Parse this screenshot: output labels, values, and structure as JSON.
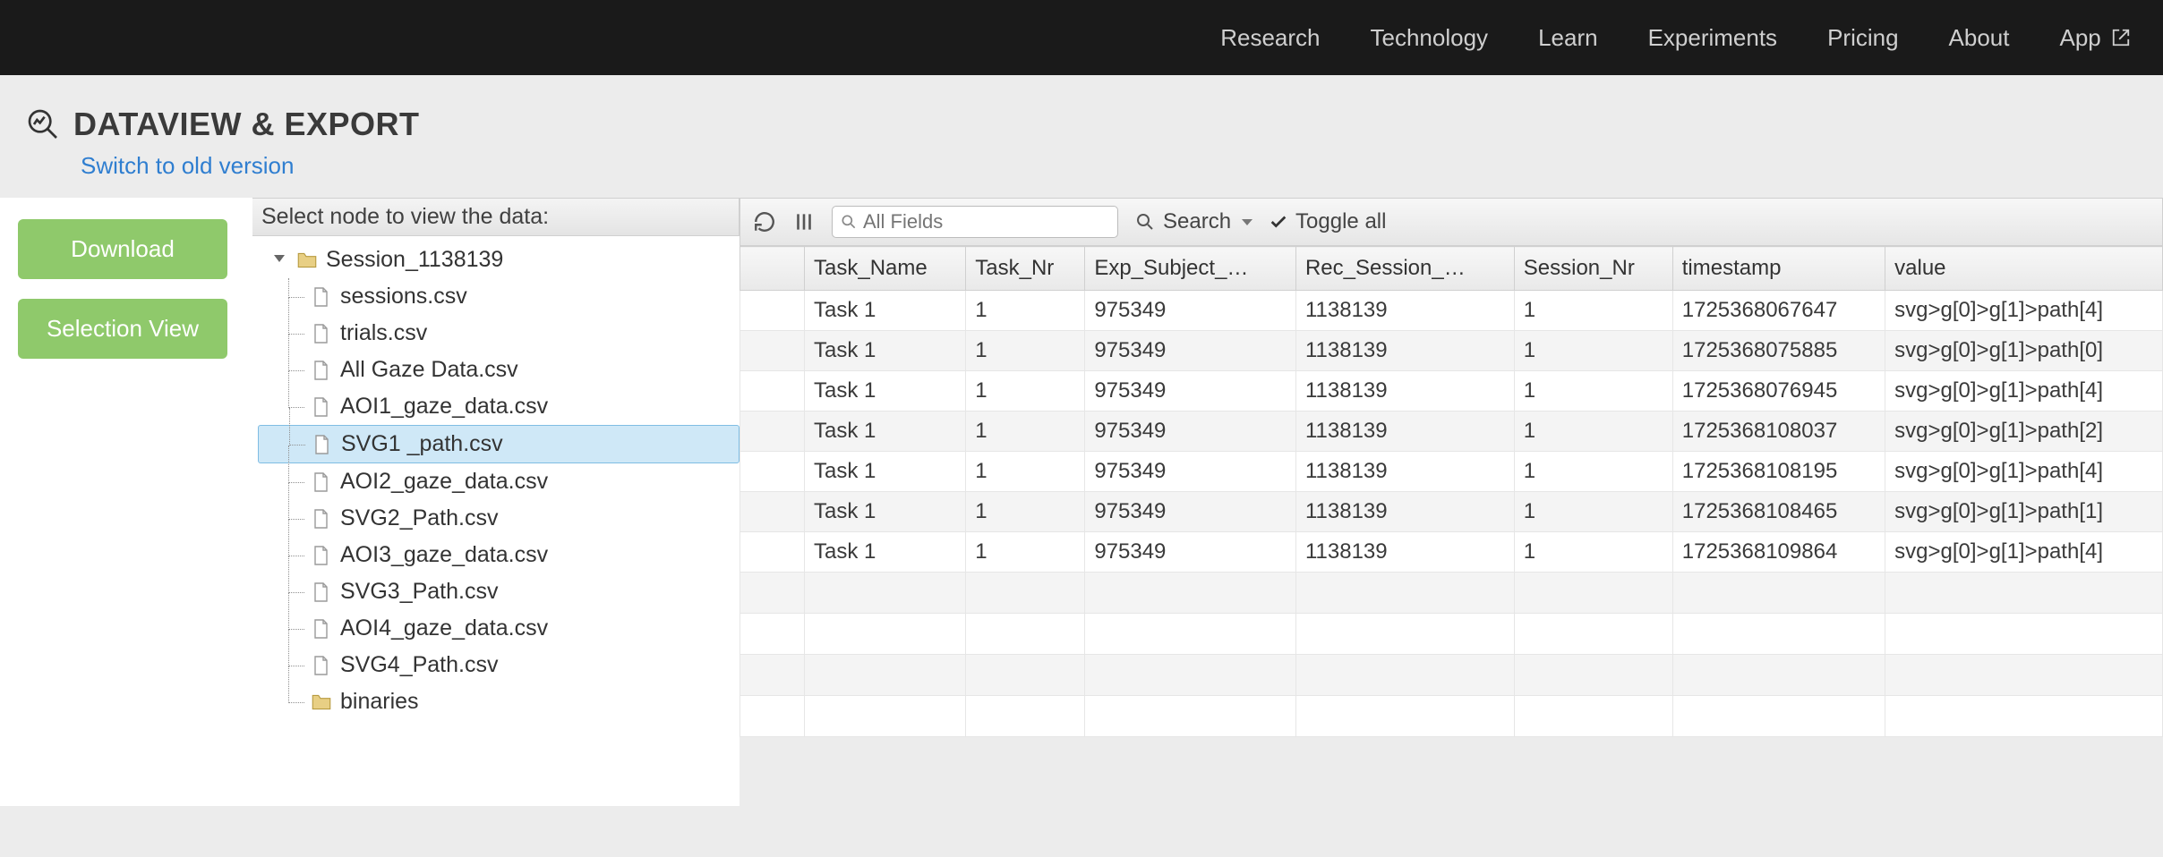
{
  "nav": {
    "items": [
      "Research",
      "Technology",
      "Learn",
      "Experiments",
      "Pricing",
      "About"
    ],
    "app_label": "App"
  },
  "header": {
    "title": "DATAVIEW & EXPORT",
    "switch_link": "Switch to old version"
  },
  "left": {
    "download": "Download",
    "selection_view": "Selection View"
  },
  "tree": {
    "header": "Select node to view the data:",
    "root": "Session_1138139",
    "children": [
      "sessions.csv",
      "trials.csv",
      "All Gaze Data.csv",
      "AOI1_gaze_data.csv",
      "SVG1 _path.csv",
      "AOI2_gaze_data.csv",
      "SVG2_Path.csv",
      "AOI3_gaze_data.csv",
      "SVG3_Path.csv",
      "AOI4_gaze_data.csv",
      "SVG4_Path.csv",
      "binaries"
    ],
    "selected_index": 4,
    "folder_indices": [
      11
    ]
  },
  "toolbar": {
    "search_placeholder": "All Fields",
    "search_label": "Search",
    "toggle_all": "Toggle all"
  },
  "table": {
    "columns": [
      "Task_Name",
      "Task_Nr",
      "Exp_Subject_…",
      "Rec_Session_…",
      "Session_Nr",
      "timestamp",
      "value"
    ],
    "rows": [
      [
        "Task 1",
        "1",
        "975349",
        "1138139",
        "1",
        "1725368067647",
        "svg>g[0]>g[1]>path[4]"
      ],
      [
        "Task 1",
        "1",
        "975349",
        "1138139",
        "1",
        "1725368075885",
        "svg>g[0]>g[1]>path[0]"
      ],
      [
        "Task 1",
        "1",
        "975349",
        "1138139",
        "1",
        "1725368076945",
        "svg>g[0]>g[1]>path[4]"
      ],
      [
        "Task 1",
        "1",
        "975349",
        "1138139",
        "1",
        "1725368108037",
        "svg>g[0]>g[1]>path[2]"
      ],
      [
        "Task 1",
        "1",
        "975349",
        "1138139",
        "1",
        "1725368108195",
        "svg>g[0]>g[1]>path[4]"
      ],
      [
        "Task 1",
        "1",
        "975349",
        "1138139",
        "1",
        "1725368108465",
        "svg>g[0]>g[1]>path[1]"
      ],
      [
        "Task 1",
        "1",
        "975349",
        "1138139",
        "1",
        "1725368109864",
        "svg>g[0]>g[1]>path[4]"
      ]
    ],
    "empty_rows": 4
  }
}
